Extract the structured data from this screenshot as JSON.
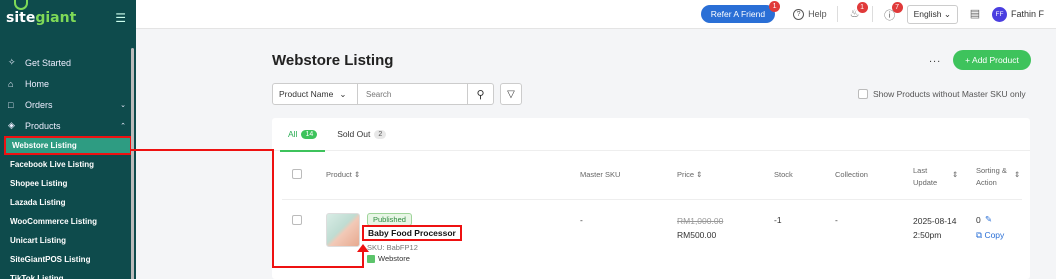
{
  "sidebar": {
    "logo_text_a": "site",
    "logo_text_b": "giant",
    "menu_icon": "hamburger-icon",
    "items": [
      {
        "label": "Get Started",
        "icon": "sparkle-icon"
      },
      {
        "label": "Home",
        "icon": "home-icon"
      },
      {
        "label": "Orders",
        "icon": "clipboard-icon"
      },
      {
        "label": "Products",
        "icon": "box-icon"
      }
    ],
    "sub_items": [
      "Webstore Listing",
      "Facebook Live Listing",
      "Shopee Listing",
      "Lazada Listing",
      "WooCommerce Listing",
      "Unicart Listing",
      "SiteGiantPOS Listing",
      "TikTok Listing"
    ]
  },
  "topbar": {
    "refer_label": "Refer A Friend",
    "refer_badge": "1",
    "help_label": "Help",
    "notif_badge": "1",
    "alert_badge": "7",
    "language": "English",
    "user_initials": "FF",
    "user_name": "Fathin F"
  },
  "page": {
    "title": "Webstore Listing",
    "more_label": "...",
    "add_label": "+ Add Product",
    "filter_select": "Product Name",
    "search_placeholder": "Search",
    "only_label": "Show Products without Master SKU only"
  },
  "tabs": [
    {
      "label": "All",
      "count": "14"
    },
    {
      "label": "Sold Out",
      "count": "2"
    }
  ],
  "table": {
    "headers": {
      "product": "Product",
      "master_sku": "Master SKU",
      "price": "Price",
      "stock": "Stock",
      "collection": "Collection",
      "last_update_1": "Last",
      "last_update_2": "Update",
      "sorting_1": "Sorting &",
      "sorting_2": "Action"
    },
    "rows": [
      {
        "status": "Published",
        "name": "Baby Food Processor",
        "sku": "SKU: BabFP12",
        "channel": "Webstore",
        "master_sku": "-",
        "old_price": "RM1,000.00",
        "price": "RM500.00",
        "stock": "-1",
        "collection": "-",
        "date": "2025-08-14",
        "time": "2:50pm",
        "sort_value": "0",
        "copy_label": "Copy"
      }
    ]
  },
  "colors": {
    "sidebar_bg": "#0e4b4c",
    "accent_green": "#3ec35c",
    "brand_blue": "#2a6fd6",
    "highlight_red": "#e11111"
  }
}
